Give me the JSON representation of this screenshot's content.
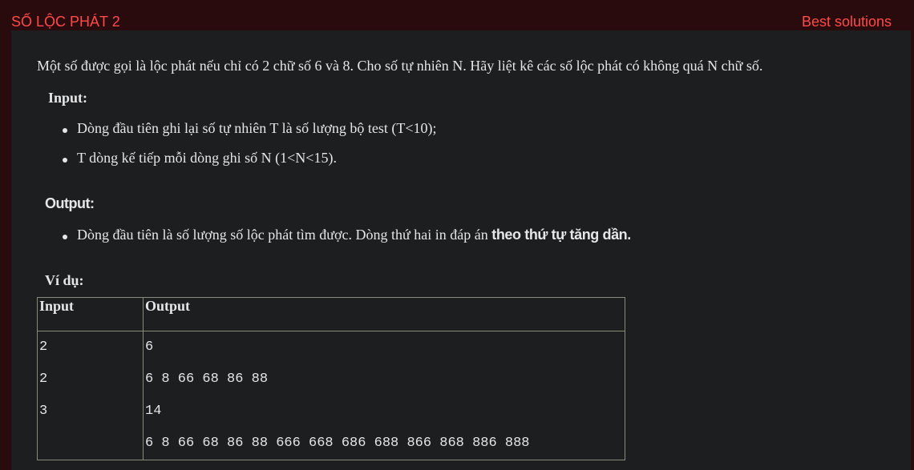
{
  "header": {
    "title": "SỐ LỘC PHÁT 2",
    "best_solutions": "Best solutions"
  },
  "description": "Một số được gọi là lộc phát nếu chỉ có 2 chữ số 6 và 8. Cho số tự nhiên N. Hãy liệt kê các số lộc phát có không quá N chữ số.",
  "input_section": {
    "heading": "Input:",
    "items": [
      "Dòng đầu tiên ghi lại số tự nhiên T là số lượng bộ test (T<10);",
      "T dòng kế tiếp mỗi dòng ghi số N (1<N<15)."
    ]
  },
  "output_section": {
    "heading": "Output:",
    "item_text": "Dòng đầu tiên là số lượng số lộc phát tìm được. Dòng thứ hai in đáp án ",
    "item_emphasis": "theo thứ tự tăng dần."
  },
  "example": {
    "heading": "Ví dụ:",
    "columns": [
      "Input",
      "Output"
    ],
    "input_lines": [
      "2",
      "2",
      "3",
      ""
    ],
    "output_lines": [
      "6",
      "6 8 66 68 86 88",
      "14",
      "6 8 66 68 86 88 666 668 686 688 866 868 886 888"
    ]
  },
  "colors": {
    "accent": "#ff4a4a",
    "frame_background": "#2a0b0d",
    "panel_background": "#1d1e20",
    "text": "#e6e6e6",
    "table_border": "#8a8a7a"
  }
}
